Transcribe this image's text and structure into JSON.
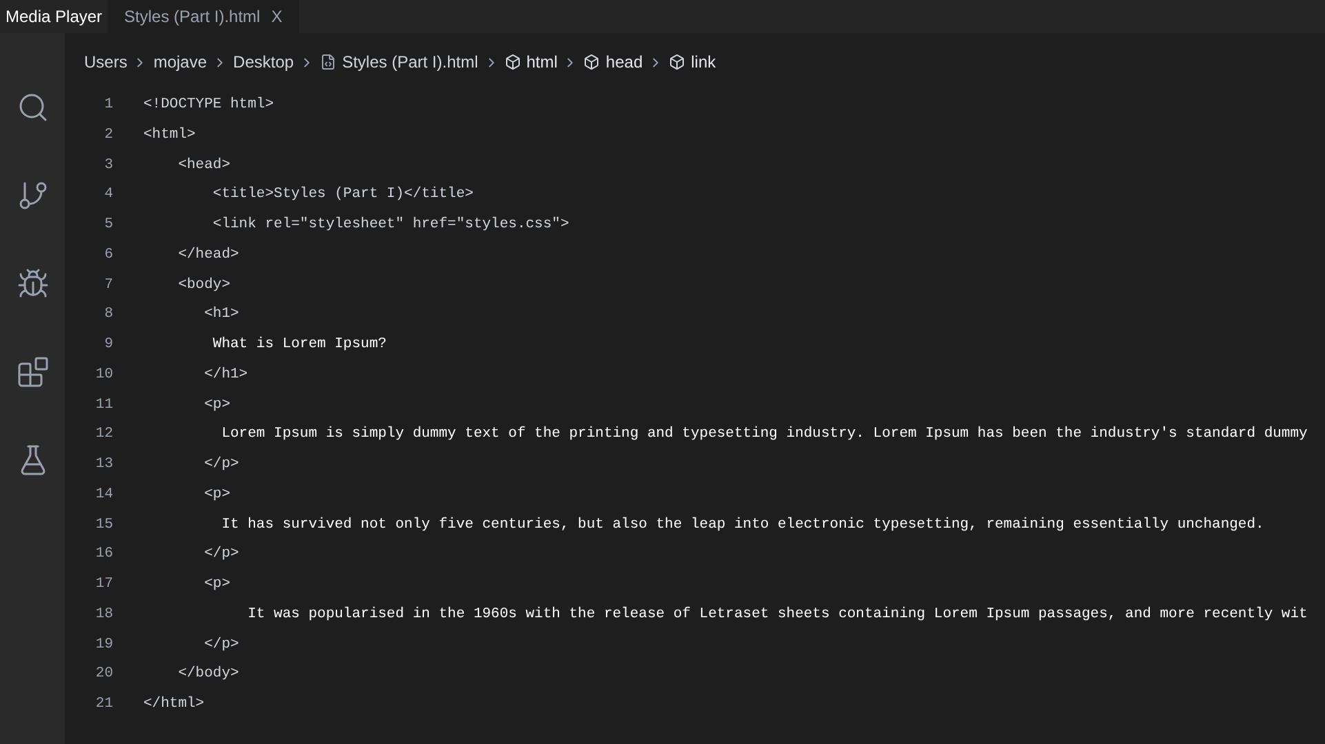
{
  "window": {
    "title": "Media Player"
  },
  "tabs": [
    {
      "label": "Styles (Part I).html",
      "close": "X",
      "selected": true
    }
  ],
  "breadcrumbs": [
    {
      "label": "Users",
      "kind": "folder"
    },
    {
      "label": "mojave",
      "kind": "folder"
    },
    {
      "label": "Desktop",
      "kind": "folder"
    },
    {
      "label": "Styles (Part I).html",
      "kind": "file"
    },
    {
      "label": "html",
      "kind": "element"
    },
    {
      "label": "head",
      "kind": "element"
    },
    {
      "label": "link",
      "kind": "element"
    }
  ],
  "activity_bar": [
    {
      "kind": "search"
    },
    {
      "kind": "source-control"
    },
    {
      "kind": "debug"
    },
    {
      "kind": "extensions"
    },
    {
      "kind": "testing"
    }
  ],
  "editor": {
    "lines": [
      {
        "number": "1",
        "text": "<!DOCTYPE html>"
      },
      {
        "number": "2",
        "text": "<html>"
      },
      {
        "number": "3",
        "text": "    <head>"
      },
      {
        "number": "4",
        "text": "        <title>Styles (Part I)</title>"
      },
      {
        "number": "5",
        "text": "        <link rel=\"stylesheet\" href=\"styles.css\">"
      },
      {
        "number": "6",
        "text": "    </head>"
      },
      {
        "number": "7",
        "text": "    <body>"
      },
      {
        "number": "8",
        "text": "       <h1>"
      },
      {
        "number": "9",
        "text": "        What is Lorem Ipsum?"
      },
      {
        "number": "10",
        "text": "       </h1>"
      },
      {
        "number": "11",
        "text": "       <p>"
      },
      {
        "number": "12",
        "text": "         Lorem Ipsum is simply dummy text of the printing and typesetting industry. Lorem Ipsum has been the industry's standard dummy"
      },
      {
        "number": "13",
        "text": "       </p>"
      },
      {
        "number": "14",
        "text": "       <p>"
      },
      {
        "number": "15",
        "text": "         It has survived not only five centuries, but also the leap into electronic typesetting, remaining essentially unchanged."
      },
      {
        "number": "16",
        "text": "       </p>"
      },
      {
        "number": "17",
        "text": "       <p>"
      },
      {
        "number": "18",
        "text": "            It was popularised in the 1960s with the release of Letraset sheets containing Lorem Ipsum passages, and more recently wit"
      },
      {
        "number": "19",
        "text": "       </p>"
      },
      {
        "number": "20",
        "text": "    </body>"
      },
      {
        "number": "21",
        "text": "</html>"
      }
    ]
  }
}
